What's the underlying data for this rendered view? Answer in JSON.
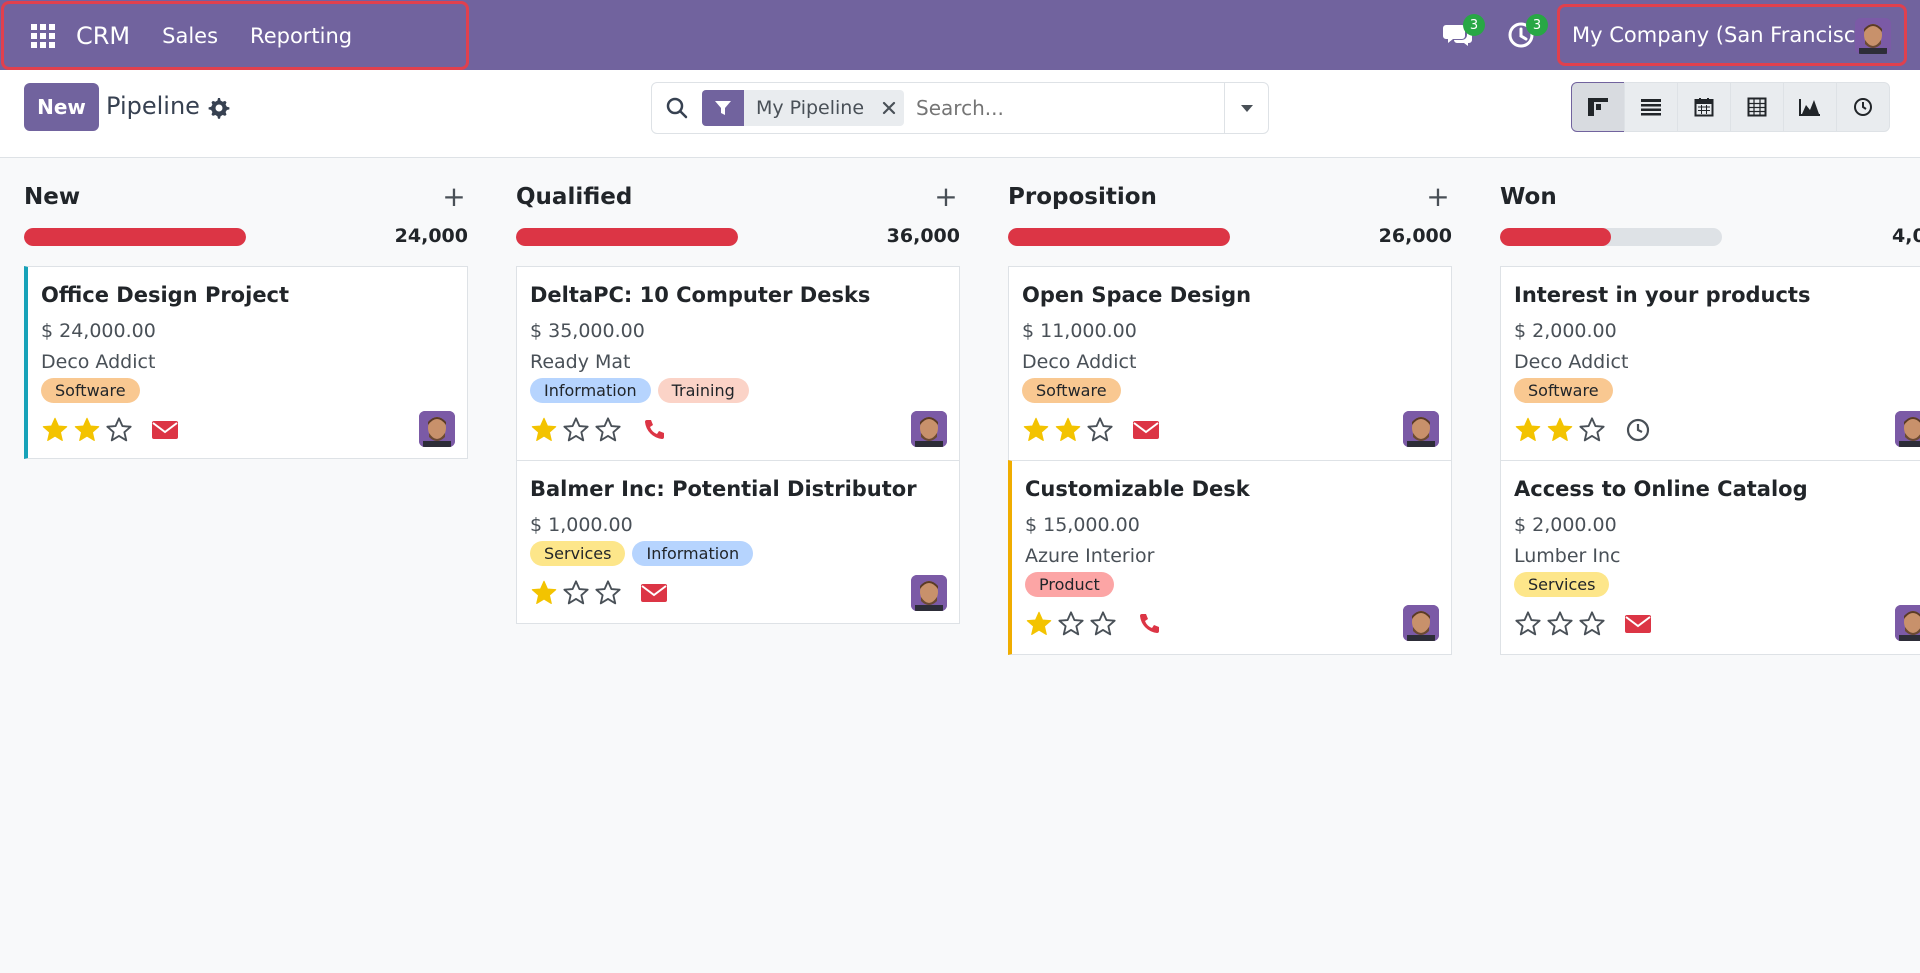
{
  "navbar": {
    "app_name": "CRM",
    "menus": [
      "Sales",
      "Reporting"
    ],
    "messages_badge": "3",
    "activities_badge": "3",
    "company": "My Company (San Francisco)"
  },
  "control_panel": {
    "new_label": "New",
    "title": "Pipeline",
    "facet_label": "My Pipeline",
    "search_placeholder": "Search..."
  },
  "colors": {
    "brand": "#71639e",
    "danger": "#dc3545",
    "star": "#f3c300"
  },
  "columns": [
    {
      "title": "New",
      "total": "24,000",
      "progress": 1.0,
      "cards": [
        {
          "title": "Office Design Project",
          "amount": "$ 24,000.00",
          "customer": "Deco Addict",
          "tags": [
            "Software"
          ],
          "stars": 2,
          "activity": "envelope-icon"
        }
      ]
    },
    {
      "title": "Qualified",
      "total": "36,000",
      "progress": 1.0,
      "cards": [
        {
          "title": "DeltaPC: 10 Computer Desks",
          "amount": "$ 35,000.00",
          "customer": "Ready Mat",
          "tags": [
            "Information",
            "Training"
          ],
          "stars": 1,
          "activity": "phone-icon"
        },
        {
          "title": "Balmer Inc: Potential Distributor",
          "amount": "$ 1,000.00",
          "customer": "",
          "tags": [
            "Services",
            "Information"
          ],
          "stars": 1,
          "activity": "envelope-icon"
        }
      ]
    },
    {
      "title": "Proposition",
      "total": "26,000",
      "progress": 1.0,
      "cards": [
        {
          "title": "Open Space Design",
          "amount": "$ 11,000.00",
          "customer": "Deco Addict",
          "tags": [
            "Software"
          ],
          "stars": 2,
          "activity": "envelope-icon"
        },
        {
          "title": "Customizable Desk",
          "amount": "$ 15,000.00",
          "customer": "Azure Interior",
          "tags": [
            "Product"
          ],
          "stars": 1,
          "activity": "phone-icon"
        }
      ]
    },
    {
      "title": "Won",
      "total": "4,0",
      "progress": 0.5,
      "cards": [
        {
          "title": "Interest in your products",
          "amount": "$ 2,000.00",
          "customer": "Deco Addict",
          "tags": [
            "Software"
          ],
          "stars": 2,
          "activity": "clock-icon"
        },
        {
          "title": "Access to Online Catalog",
          "amount": "$ 2,000.00",
          "customer": "Lumber Inc",
          "tags": [
            "Services"
          ],
          "stars": 0,
          "activity": "envelope-icon"
        }
      ]
    }
  ]
}
